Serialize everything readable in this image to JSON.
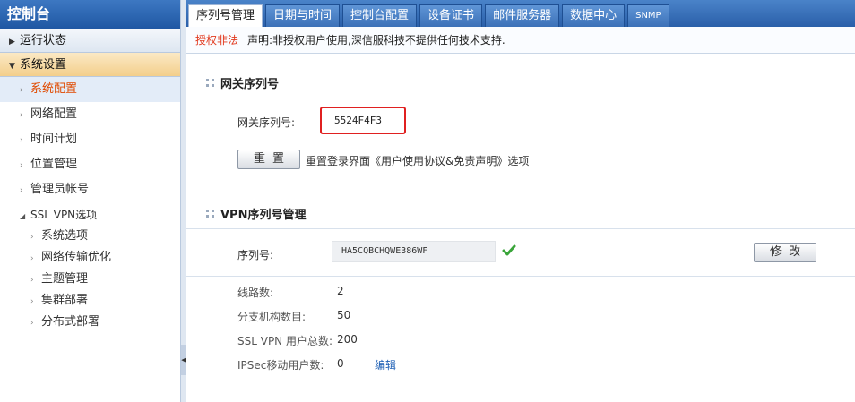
{
  "sidebar": {
    "title": "控制台",
    "sections": [
      {
        "label": "运行状态",
        "open": false
      },
      {
        "label": "系统设置",
        "open": true
      }
    ],
    "items": [
      {
        "label": "系统配置",
        "active": true
      },
      {
        "label": "网络配置"
      },
      {
        "label": "时间计划"
      },
      {
        "label": "位置管理"
      },
      {
        "label": "管理员帐号"
      }
    ],
    "ssl_group": {
      "label": "SSL VPN选项",
      "items": [
        "系统选项",
        "网络传输优化",
        "主题管理",
        "集群部署",
        "分布式部署"
      ]
    }
  },
  "tabs": [
    {
      "label": "序列号管理",
      "active": true
    },
    {
      "label": "日期与时间"
    },
    {
      "label": "控制台配置"
    },
    {
      "label": "设备证书"
    },
    {
      "label": "邮件服务器"
    },
    {
      "label": "数据中心"
    },
    {
      "label": "SNMP"
    }
  ],
  "notice": {
    "warning": "授权非法",
    "text": "声明:非授权用户使用,深信服科技不提供任何技术支持."
  },
  "gateway": {
    "heading": "网关序列号",
    "label": "网关序列号:",
    "value": "5524F4F3",
    "reset_label": "重置",
    "reset_desc": "重置登录界面《用户使用协议&免责声明》选项"
  },
  "vpn": {
    "heading": "VPN序列号管理",
    "serial_label": "序列号:",
    "serial_value": "HA5CQBCHQWE386WF",
    "edit_label": "修改",
    "stats": [
      {
        "label": "线路数:",
        "value": "2"
      },
      {
        "label": "分支机构数目:",
        "value": "50"
      },
      {
        "label": "SSL VPN 用户总数:",
        "value": "200"
      },
      {
        "label": "IPSec移动用户数:",
        "value": "0"
      }
    ],
    "edit_link": "编辑"
  },
  "colors": {
    "accent": "#2a5fa9",
    "warning": "#e23a1f",
    "highlight_box": "#e02020",
    "link": "#1d5fb5",
    "active_item": "#e04a00"
  }
}
